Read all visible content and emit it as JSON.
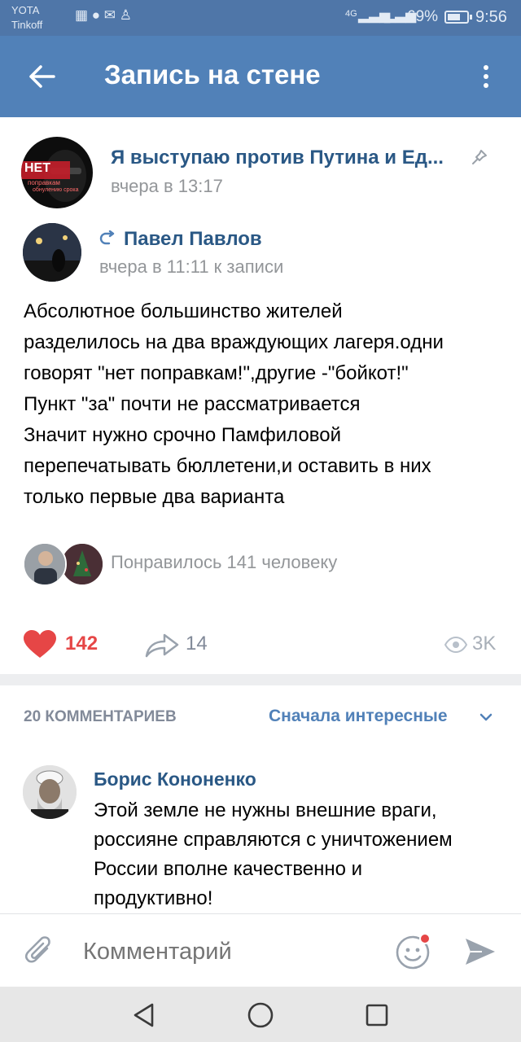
{
  "status_bar": {
    "carrier_1": "YOTA",
    "carrier_2": "Tinkoff",
    "network_left": "4G",
    "battery": "69%",
    "battery_level": 0.69,
    "time": "9:56"
  },
  "toolbar": {
    "title": "Запись на стене",
    "back_icon": "arrow-left-icon",
    "menu_icon": "more-vertical-icon"
  },
  "post": {
    "group_name": "Я выступаю против Путина и Ед...",
    "group_avatar_text": "НЕТ",
    "group_avatar_subtext_1": "поправкам",
    "group_avatar_subtext_2": "обнулению срока",
    "time": "вчера в 13:17",
    "pin_icon": "pin-icon",
    "repost": {
      "author": "Павел Павлов",
      "time": "вчера в 11:11 к записи",
      "repost_icon": "repost-arrow-icon"
    },
    "text_lines": [
      "Абсолютное большинство жителей",
      "разделилось на два враждующих лагеря.одни",
      "говорят \"нет поправкам!\",другие -\"бойкот!\"",
      "Пункт \"за\" почти не рассматривается",
      "Значит нужно срочно Памфиловой",
      "перепечатывать бюллетени,и оставить в них",
      "только первые два варианта"
    ],
    "likes_text": "Понравилось 141 человеку",
    "like_count": "142",
    "share_count": "14",
    "views": "3K"
  },
  "comments": {
    "header": "20 КОММЕНТАРИЕВ",
    "sort_label": "Сначала интересные",
    "items": [
      {
        "author": "Борис Кононенко",
        "text_lines": [
          "Этой земле не нужны внешние враги,",
          "россияне справляются с уничтожением",
          "России вполне качественно и",
          "продуктивно!"
        ]
      }
    ]
  },
  "input": {
    "placeholder": "Комментарий",
    "attach_icon": "paperclip-icon",
    "sticker_icon": "smiley-icon",
    "send_icon": "send-icon"
  },
  "colors": {
    "header_blue": "#5181b8",
    "status_blue": "#4f76a8",
    "link_blue": "#2a5885",
    "like_red": "#e64646",
    "gray_text": "#939699"
  }
}
